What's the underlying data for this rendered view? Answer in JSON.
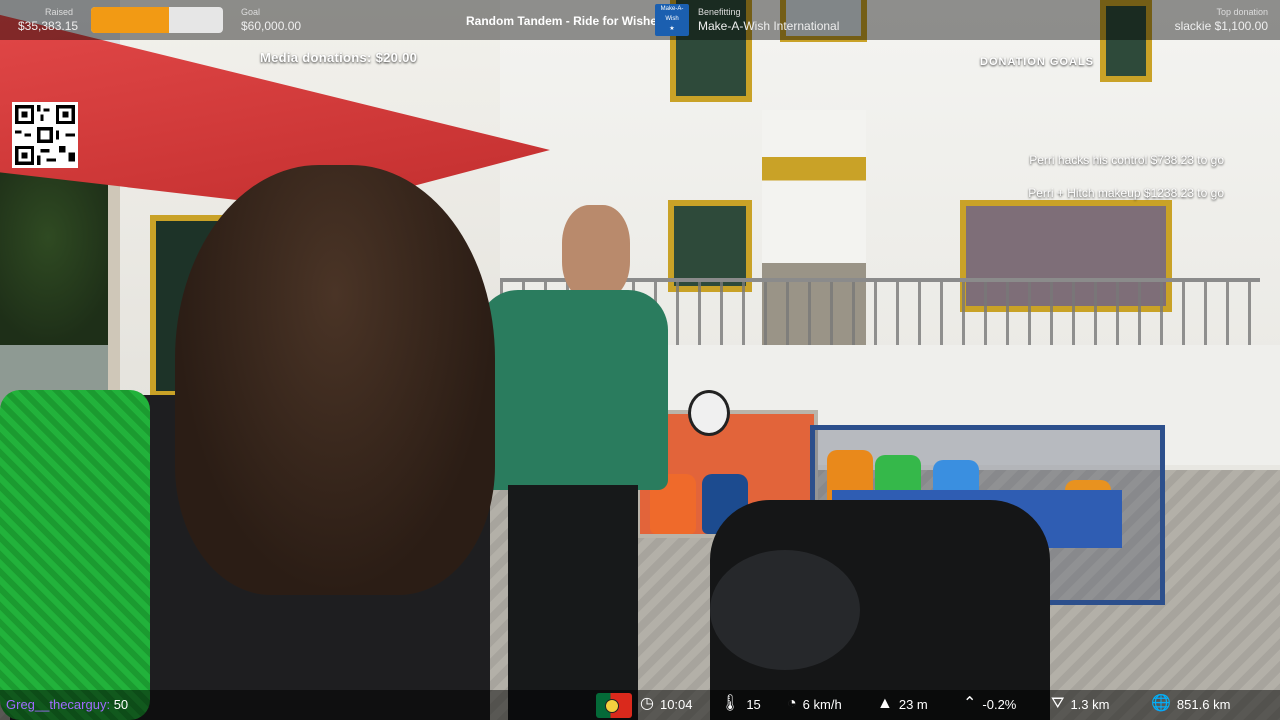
{
  "top_bar": {
    "raised_label": "Raised",
    "raised_value": "$35,383.15",
    "progress_fraction": 0.59,
    "goal_label": "Goal",
    "goal_value": "$60,000.00",
    "event_title": "Random Tandem - Ride for Wishes",
    "benefitting_label": "Benefitting",
    "benefitting_value": "Make-A-Wish International",
    "top_donation_label": "Top donation",
    "top_donation_value": "slackie $1,100.00",
    "accent_color": "#f29a14"
  },
  "media_donations": "Media donations: $20.00",
  "donation_goals": {
    "title": "DONATION GOALS",
    "goals": [
      {
        "text": "Perri hacks his control  $738.23 to go"
      },
      {
        "text": "Perri + Hitch makeup  $1238.23 to go"
      }
    ]
  },
  "qr_icon": "qr-code-icon",
  "bottom_bar": {
    "chat_user": "Greg__thecarguy:",
    "chat_value": "50",
    "stats": [
      {
        "icon": "clock-icon",
        "value": "10:04"
      },
      {
        "icon": "thermometer-icon",
        "value": "15"
      },
      {
        "icon": "speedometer-icon",
        "value": "6 km/h"
      },
      {
        "icon": "mountain-icon",
        "value": "23 m"
      },
      {
        "icon": "incline-icon",
        "value": "-0.2%"
      },
      {
        "icon": "road-icon",
        "value": "1.3 km"
      },
      {
        "icon": "globe-icon",
        "value": "851.6 km"
      }
    ]
  }
}
